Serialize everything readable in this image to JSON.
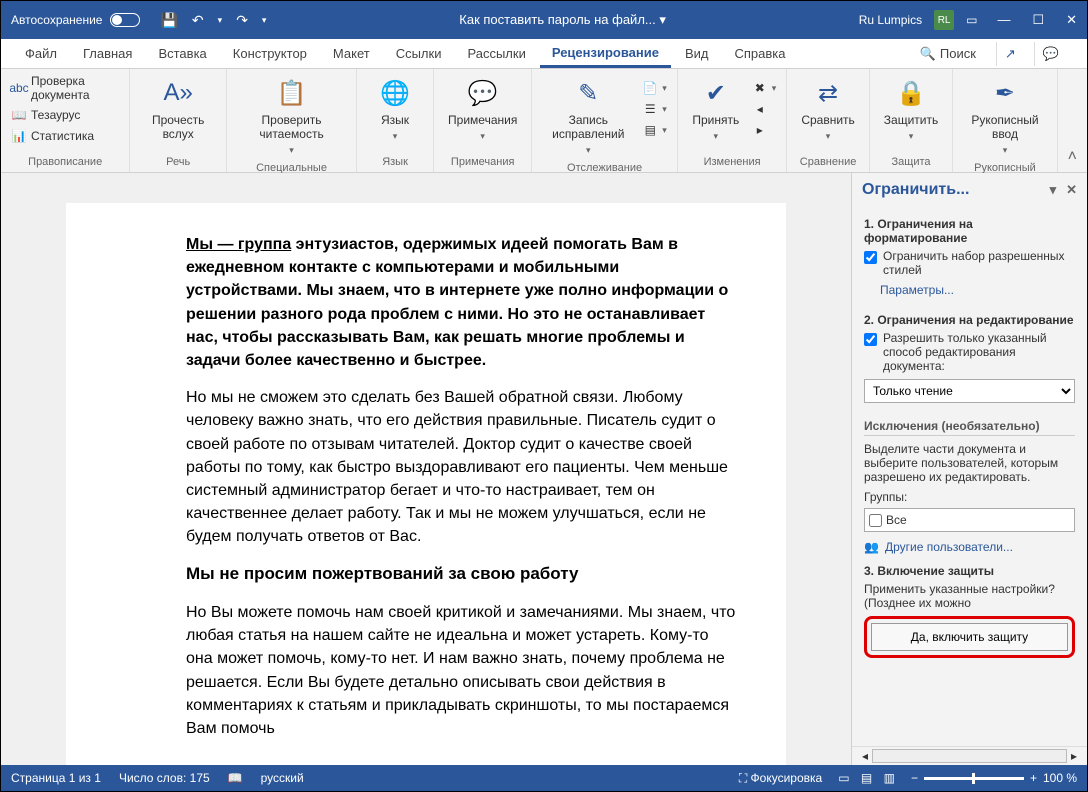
{
  "titlebar": {
    "autosave": "Автосохранение",
    "doc_title": "Как поставить пароль на файл...  ▾",
    "user_name": "Ru Lumpics",
    "user_initials": "RL"
  },
  "tabs": {
    "file": "Файл",
    "home": "Главная",
    "insert": "Вставка",
    "design": "Конструктор",
    "layout": "Макет",
    "references": "Ссылки",
    "mailings": "Рассылки",
    "review": "Рецензирование",
    "view": "Вид",
    "help": "Справка",
    "search": "Поиск"
  },
  "ribbon": {
    "proofing": {
      "spellcheck": "Проверка документа",
      "thesaurus": "Тезаурус",
      "stats": "Статистика",
      "label": "Правописание"
    },
    "speech": {
      "read": "Прочесть вслух",
      "label": "Речь"
    },
    "accessibility": {
      "check": "Проверить читаемость",
      "label": "Специальные возможности"
    },
    "language": {
      "btn": "Язык",
      "label": "Язык"
    },
    "comments": {
      "btn": "Примечания",
      "label": "Примечания"
    },
    "tracking": {
      "track": "Запись исправлений",
      "label": "Отслеживание"
    },
    "changes": {
      "accept": "Принять",
      "label": "Изменения"
    },
    "compare": {
      "btn": "Сравнить",
      "label": "Сравнение"
    },
    "protect": {
      "btn": "Защитить",
      "label": "Защита"
    },
    "ink": {
      "btn": "Рукописный ввод",
      "label": "Рукописный ввод"
    }
  },
  "document": {
    "p1_link": "Мы — группа",
    "p1_rest": " энтузиастов, одержимых идеей помогать Вам в ежедневном контакте с компьютерами и мобильными устройствами. Мы знаем, что в интернете уже полно информации о решении разного рода проблем с ними. Но это не останавливает нас, чтобы рассказывать Вам, как решать многие проблемы и задачи более качественно и быстрее.",
    "p2": "Но мы не сможем это сделать без Вашей обратной связи. Любому человеку важно знать, что его действия правильные. Писатель судит о своей работе по отзывам читателей. Доктор судит о качестве своей работы по тому, как быстро выздоравливают его пациенты. Чем меньше системный администратор бегает и что-то настраивает, тем он качественнее делает работу. Так и мы не можем улучшаться, если не будем получать ответов от Вас.",
    "h3": "Мы не просим пожертвований за свою работу",
    "p3": "Но Вы можете помочь нам своей критикой и замечаниями. Мы знаем, что любая статья на нашем сайте не идеальна и может устареть. Кому-то она может помочь, кому-то нет. И нам важно знать, почему проблема не решается. Если Вы будете детально описывать свои действия в комментариях к статьям и прикладывать скриншоты, то мы постараемся Вам помочь"
  },
  "panel": {
    "title": "Ограничить...",
    "s1_title": "1. Ограничения на форматирование",
    "s1_check": "Ограничить набор разрешенных стилей",
    "s1_link": "Параметры...",
    "s2_title": "2. Ограничения на редактирование",
    "s2_check": "Разрешить только указанный способ редактирования документа:",
    "s2_select": "Только чтение",
    "excl_title": "Исключения (необязательно)",
    "excl_text": "Выделите части документа и выберите пользователей, которым разрешено их редактировать.",
    "groups_label": "Группы:",
    "groups_all": "Все",
    "more_users": "Другие пользователи...",
    "s3_title": "3. Включение защиты",
    "s3_text": "Применить указанные настройки? (Позднее их можно",
    "s3_btn": "Да, включить защиту"
  },
  "statusbar": {
    "page": "Страница 1 из 1",
    "words": "Число слов: 175",
    "lang": "русский",
    "focus": "Фокусировка",
    "zoom": "100 %"
  }
}
